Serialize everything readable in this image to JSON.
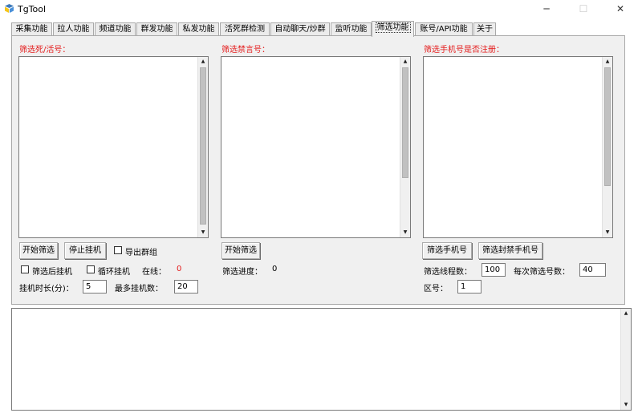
{
  "window": {
    "title": "TgTool",
    "minimize": "─",
    "maximize": "☐",
    "close": "✕"
  },
  "tabs": [
    {
      "label": "采集功能"
    },
    {
      "label": "拉人功能"
    },
    {
      "label": "频道功能"
    },
    {
      "label": "群发功能"
    },
    {
      "label": "私发功能"
    },
    {
      "label": "活死群检测"
    },
    {
      "label": "自动聊天/炒群"
    },
    {
      "label": "监听功能"
    },
    {
      "label": "筛选功能"
    },
    {
      "label": "账号/API功能"
    },
    {
      "label": "关于"
    }
  ],
  "col1": {
    "title": "筛选死/活号：",
    "start_button": "开始筛选",
    "stop_button": "停止挂机",
    "export_label": "导出群组",
    "after_filter_label": "筛选后挂机",
    "loop_label": "循环挂机",
    "online_label": "在线：",
    "online_value": "0",
    "duration_label": "挂机时长(分)：",
    "duration_value": "5",
    "max_label": "最多挂机数：",
    "max_value": "20"
  },
  "col2": {
    "title": "筛选禁言号：",
    "start_button": "开始筛选",
    "progress_label": "筛选进度：",
    "progress_value": "0"
  },
  "col3": {
    "title": "筛选手机号是否注册：",
    "filter_phone_button": "筛选手机号",
    "filter_banned_button": "筛选封禁手机号",
    "threads_label": "筛选线程数：",
    "threads_value": "100",
    "per_label": "每次筛选号数：",
    "per_value": "40",
    "area_label": "区号：",
    "area_value": "1"
  },
  "colors": {
    "accent_red": "#e41a1a",
    "panel_bg": "#f0f0f0"
  }
}
